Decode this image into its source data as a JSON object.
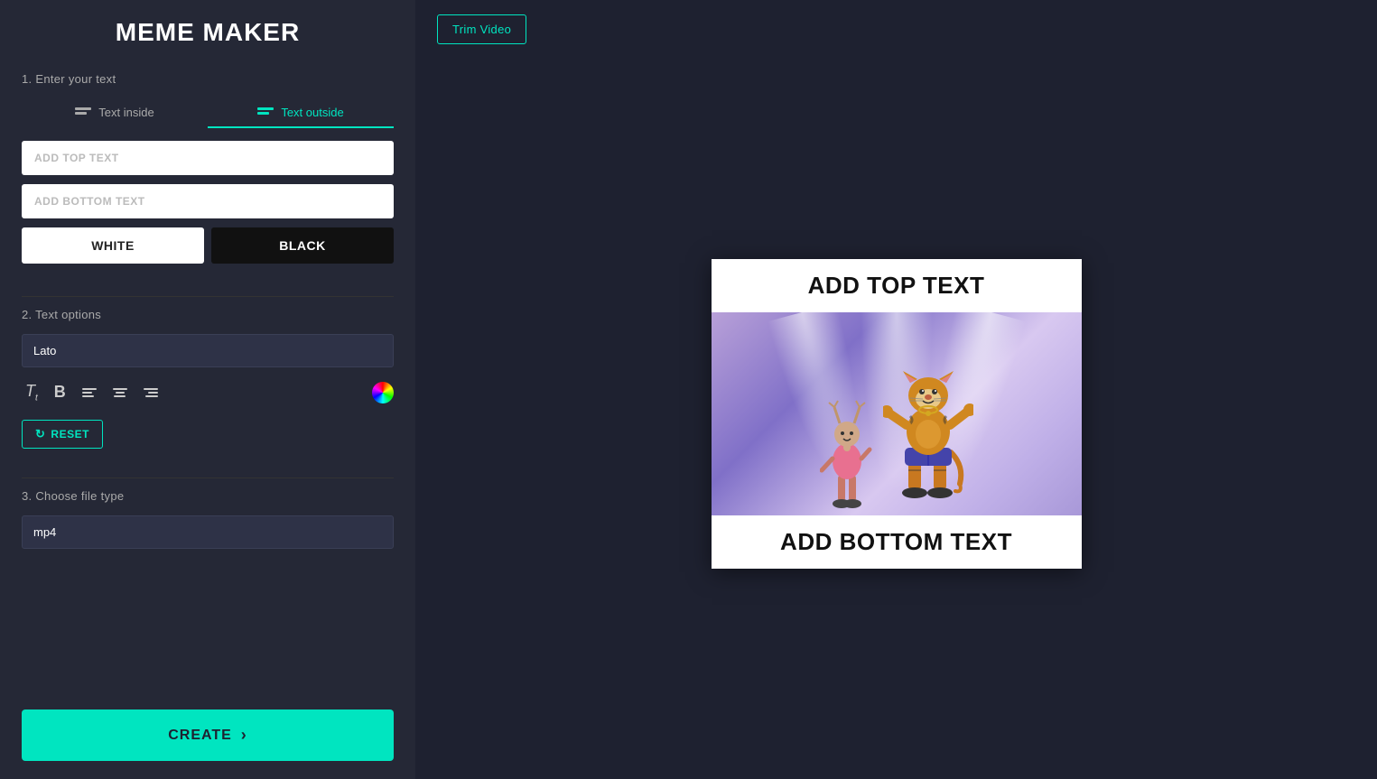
{
  "app": {
    "title": "MEME MAKER"
  },
  "left_panel": {
    "section1_label": "1. Enter your text",
    "tab_inside_label": "Text inside",
    "tab_outside_label": "Text outside",
    "top_text_placeholder": "ADD TOP TEXT",
    "bottom_text_placeholder": "ADD BOTTOM TEXT",
    "white_btn_label": "WHITE",
    "black_btn_label": "BLACK",
    "section2_label": "2. Text options",
    "font_value": "Lato",
    "reset_btn_label": "RESET",
    "section3_label": "3. Choose file type",
    "file_type_value": "mp4",
    "create_btn_label": "CREATE"
  },
  "right_panel": {
    "trim_video_btn_label": "Trim Video",
    "meme_top_text": "ADD TOP TEXT",
    "meme_bottom_text": "ADD BOTTOM TEXT"
  },
  "colors": {
    "accent": "#00e5c0",
    "bg_dark": "#1e2130",
    "bg_panel": "#252836",
    "bg_input": "#2e3247"
  }
}
